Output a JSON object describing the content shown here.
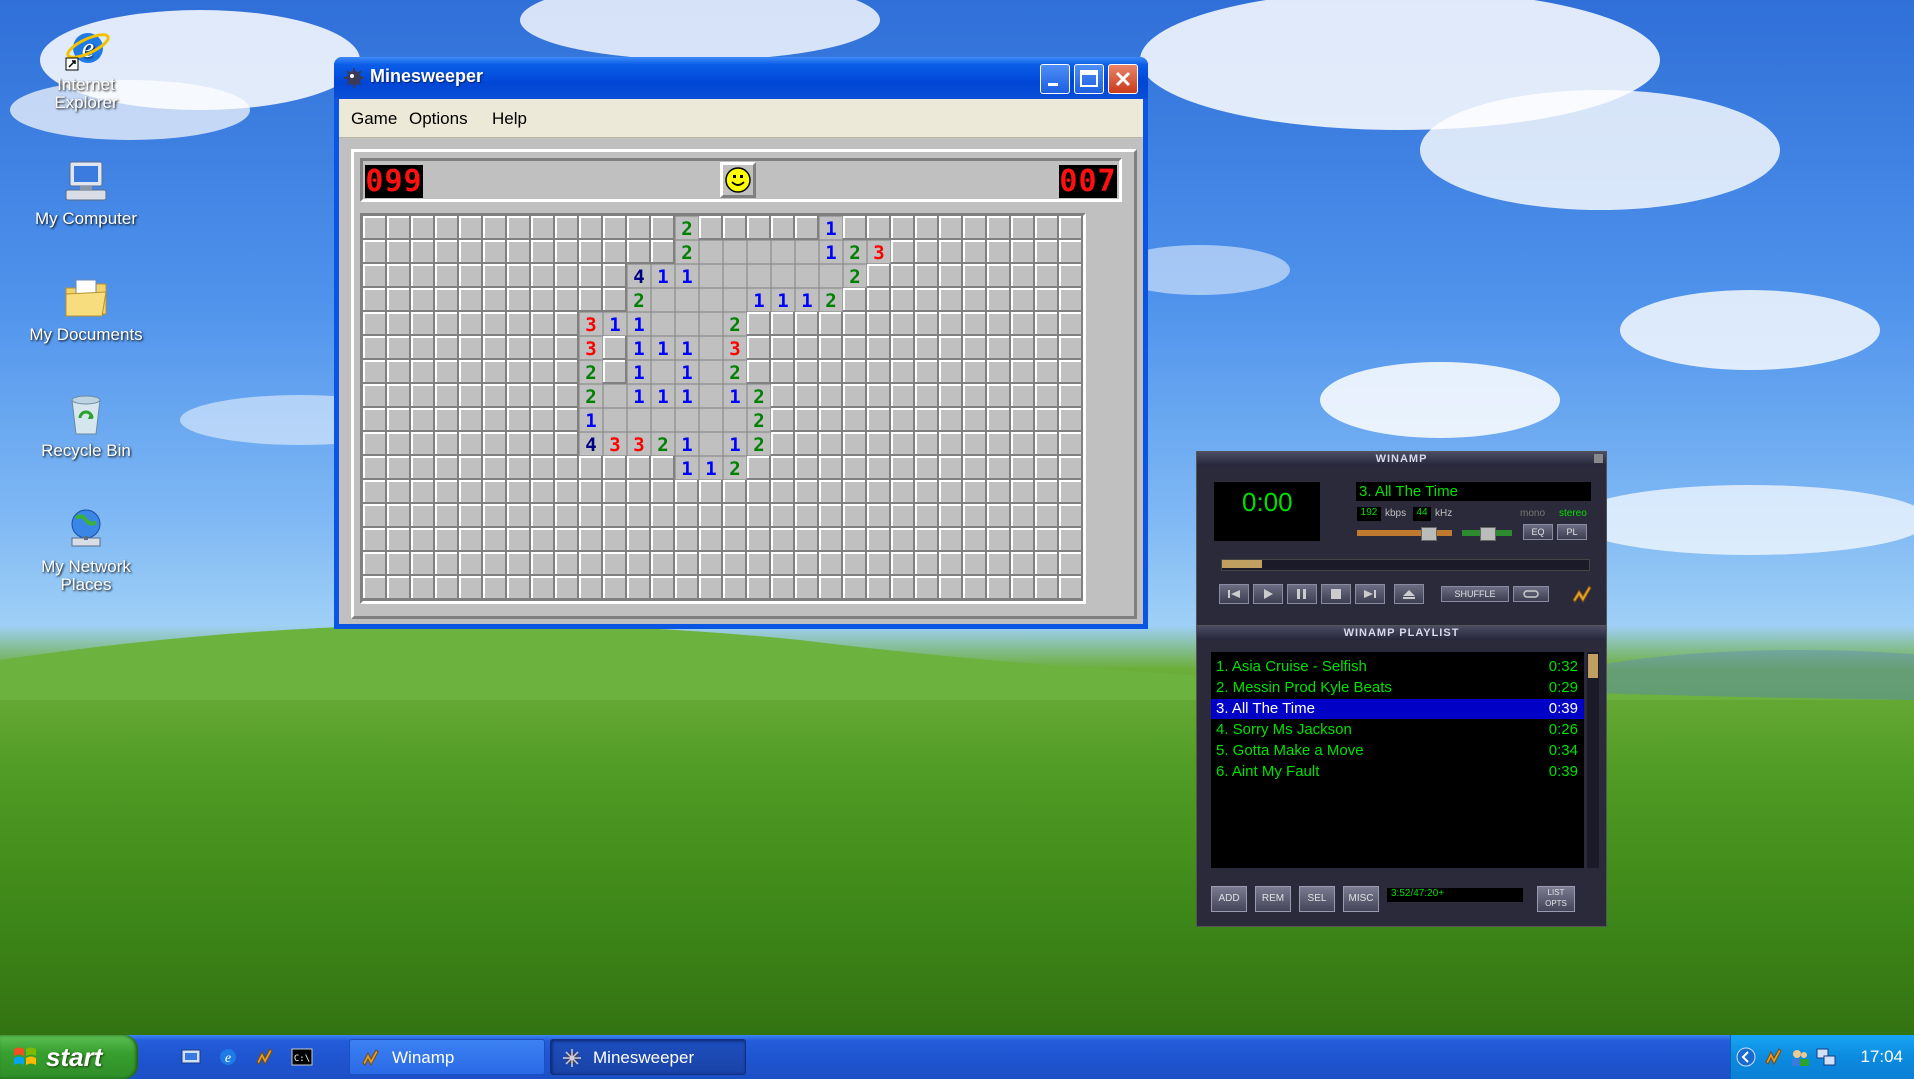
{
  "desktop": {
    "icons": [
      {
        "label_line1": "Internet",
        "label_line2": "Explorer",
        "icon": "internet-explorer-icon"
      },
      {
        "label_line1": "My Computer",
        "label_line2": "",
        "icon": "my-computer-icon"
      },
      {
        "label_line1": "My Documents",
        "label_line2": "",
        "icon": "my-documents-icon"
      },
      {
        "label_line1": "Recycle Bin",
        "label_line2": "",
        "icon": "recycle-bin-icon"
      },
      {
        "label_line1": "My Network",
        "label_line2": "Places",
        "icon": "network-places-icon"
      }
    ]
  },
  "minesweeper": {
    "title": "Minesweeper",
    "menu": [
      "Game",
      "Options",
      "Help"
    ],
    "mines_left": "099",
    "timer": "007",
    "face": "smiley",
    "rows": [
      "#############2#####1##########",
      "#############2.....123########",
      "###########411......2#########",
      "###########2....1112##########",
      "#########311...2##############",
      "#########3#111.3##############",
      "#########2#1.1.2##############",
      "#########2.111.12#############",
      "#########1......2#############",
      "#########43321.12#############",
      "#############112##############",
      "##############################",
      "##############################",
      "##############################",
      "##############################",
      "##############################"
    ]
  },
  "winamp": {
    "title": "WINAMP",
    "time": "0:00",
    "track": "3. All The Time",
    "kbps": "192",
    "kbps_label": "kbps",
    "khz": "44",
    "khz_label": "kHz",
    "mono_label": "mono",
    "stereo_label": "stereo",
    "eq_label": "EQ",
    "pl_label": "PL",
    "shuffle_label": "SHUFFLE",
    "playlist_title": "WINAMP PLAYLIST",
    "playlist": [
      {
        "title": "1. Asia Cruise - Selfish",
        "duration": "0:32"
      },
      {
        "title": "2. Messin Prod Kyle Beats",
        "duration": "0:29"
      },
      {
        "title": "3. All The Time",
        "duration": "0:39"
      },
      {
        "title": "4. Sorry Ms Jackson",
        "duration": "0:26"
      },
      {
        "title": "5. Gotta Make a Move",
        "duration": "0:34"
      },
      {
        "title": "6. Aint My Fault",
        "duration": "0:39"
      }
    ],
    "selected_index": 2,
    "pl_buttons": [
      "ADD",
      "REM",
      "SEL",
      "MISC"
    ],
    "list_opts": "LIST OPTS",
    "pl_time": "3:52/47:20+"
  },
  "taskbar": {
    "start_label": "start",
    "tasks": [
      {
        "label": "Winamp",
        "icon": "winamp-icon"
      },
      {
        "label": "Minesweeper",
        "icon": "minesweeper-icon"
      }
    ],
    "clock": "17:04"
  },
  "colors": {
    "num1": "#0000ff",
    "num2": "#008000",
    "num3": "#ff0000",
    "num4": "#000080",
    "xp_blue": "#0a55e2",
    "winamp_green": "#00e000"
  }
}
